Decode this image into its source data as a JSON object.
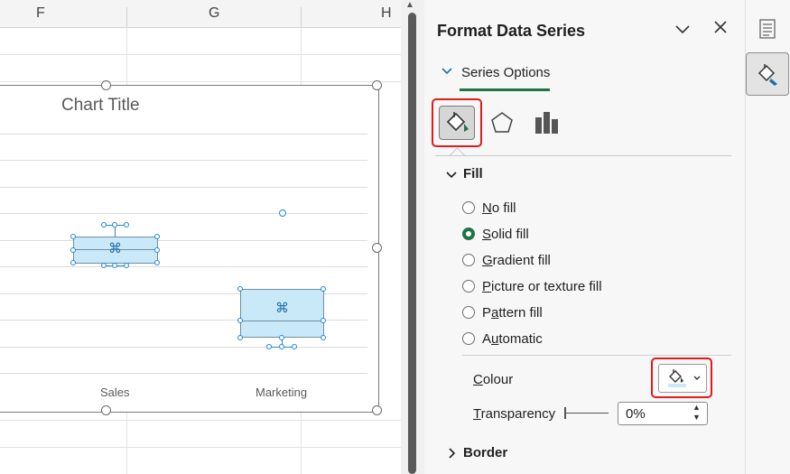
{
  "sheet": {
    "columns": [
      "F",
      "G",
      "H"
    ]
  },
  "chart": {
    "title": "Chart Title",
    "categories": [
      "Sales",
      "Marketing"
    ]
  },
  "pane": {
    "title": "Format Data Series",
    "collapse_icon": "chevron-down-icon",
    "close_icon": "close-icon",
    "section": "Series Options",
    "tabs": [
      "fill-line-icon",
      "effects-pentagon-icon",
      "series-options-bars-icon"
    ],
    "fill": {
      "heading": "Fill",
      "options": [
        {
          "pre": "",
          "key": "N",
          "post": "o fill",
          "selected": false
        },
        {
          "pre": "",
          "key": "S",
          "post": "olid fill",
          "selected": true
        },
        {
          "pre": "",
          "key": "G",
          "post": "radient fill",
          "selected": false
        },
        {
          "pre": "",
          "key": "P",
          "post": "icture or texture fill",
          "selected": false
        },
        {
          "pre": "P",
          "key": "a",
          "post": "ttern fill",
          "selected": false
        },
        {
          "pre": "A",
          "key": "u",
          "post": "tomatic",
          "selected": false
        }
      ],
      "colour_pre": "",
      "colour_key": "C",
      "colour_post": "olour",
      "transparency_pre": "",
      "transparency_key": "T",
      "transparency_post": "ransparency",
      "transparency_value": "0%"
    },
    "border": {
      "heading": "Border"
    }
  },
  "colors": {
    "accent_green": "#217346",
    "highlight_red": "#e01b1b",
    "box_fill": "#c9e9f8",
    "selection_blue": "#1f87d6"
  }
}
